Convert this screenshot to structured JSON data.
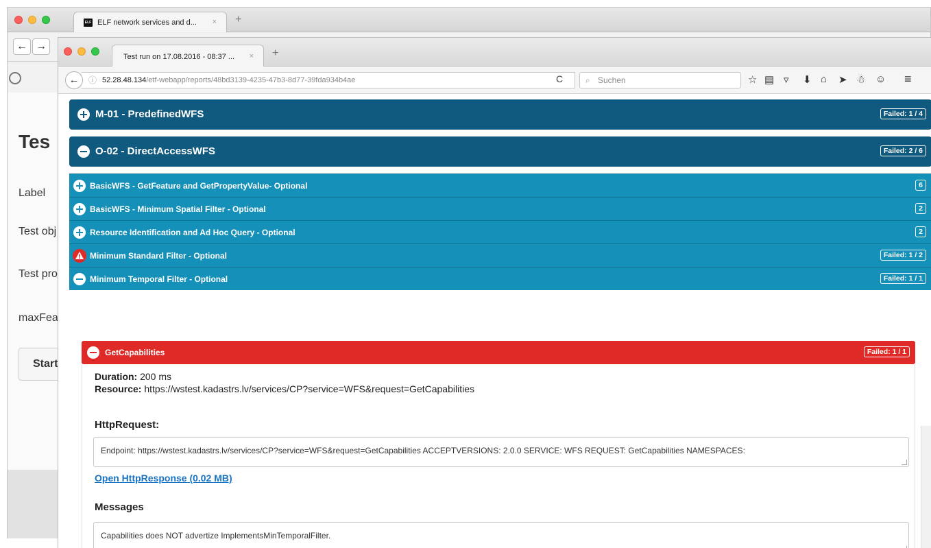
{
  "background_window": {
    "tab_title": "ELF network services and d...",
    "tab_favicon": "ELF",
    "close_glyph": "×",
    "new_tab_glyph": "+",
    "back_glyph": "🡠",
    "forward_glyph": "→",
    "heading": "Tes",
    "labels": [
      "Label",
      "Test obj",
      "Test pro",
      "maxFea"
    ],
    "start_button": "Start"
  },
  "browser": {
    "tab_title": "Test run on 17.08.2016 - 08:37 ...",
    "close_glyph": "×",
    "new_tab_glyph": "+",
    "back_glyph": "←",
    "info_glyph": "ⓘ",
    "url_host": "52.28.48.134",
    "url_path": "/etf-webapp/reports/48bd3139-4235-47b3-8d77-39fda934b4ae",
    "reload_glyph": "C",
    "search_placeholder": "Suchen",
    "search_glyph": "⌕",
    "toolbar_icons": {
      "bookmark_star": "☆",
      "reading_list": "▤",
      "pocket": "▿",
      "download": "⬇",
      "home": "⌂",
      "send": "➤",
      "mic": "☃",
      "smiley": "☺",
      "menu": "≡"
    }
  },
  "report": {
    "modules": [
      {
        "title": "M-01 - PredefinedWFS",
        "badge": "Failed: 1 / 4",
        "state": "collapsed"
      },
      {
        "title": "O-02 - DirectAccessWFS",
        "badge": "Failed: 2 / 6",
        "state": "expanded"
      }
    ],
    "test_cases": [
      {
        "title": "BasicWFS - GetFeature and GetPropertyValue- Optional",
        "badge": "6",
        "status": "collapsed"
      },
      {
        "title": "BasicWFS - Minimum Spatial Filter - Optional",
        "badge": "2",
        "status": "collapsed"
      },
      {
        "title": "Resource Identification and Ad Hoc Query - Optional",
        "badge": "2",
        "status": "collapsed"
      },
      {
        "title": "Minimum Standard Filter - Optional",
        "badge": "Failed: 1 / 2",
        "status": "warning"
      },
      {
        "title": "Minimum Temporal Filter - Optional",
        "badge": "Failed: 1 / 1",
        "status": "expanded"
      }
    ],
    "step": {
      "title": "GetCapabilities",
      "badge": "Failed: 1 / 1",
      "duration_label": "Duration:",
      "duration_value": "200 ms",
      "resource_label": "Resource:",
      "resource_value": "https://wstest.kadastrs.lv/services/CP?service=WFS&request=GetCapabilities",
      "http_request_heading": "HttpRequest:",
      "http_request_text": "Endpoint: https://wstest.kadastrs.lv/services/CP?service=WFS&request=GetCapabilities ACCEPTVERSIONS: 2.0.0 SERVICE: WFS REQUEST: GetCapabilities NAMESPACES:",
      "response_link": "Open HttpResponse (0.02 MB)",
      "messages_heading": "Messages",
      "messages_text": "Capabilities does NOT advertize ImplementsMinTemporalFilter."
    }
  },
  "colors": {
    "module_header": "#0f5a7e",
    "test_case_header": "#1590b8",
    "failed_step": "#e02a28",
    "link": "#1a73c1"
  }
}
